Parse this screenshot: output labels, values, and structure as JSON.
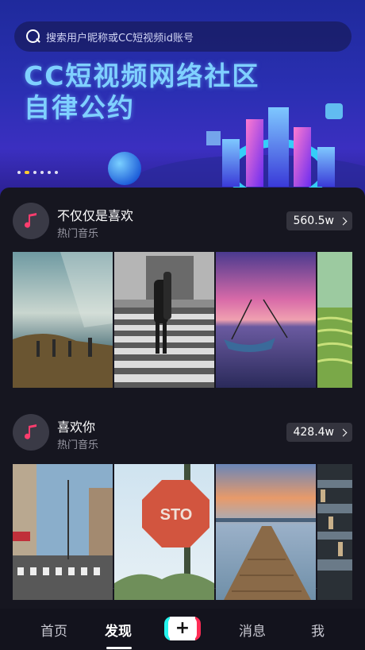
{
  "search": {
    "placeholder": "搜索用户昵称或CC短视频id账号"
  },
  "banner": {
    "title_line1": "CC短视频网络社区",
    "title_line2": "自律公约",
    "carousel_dots": 6,
    "carousel_active_index": 1
  },
  "sections": [
    {
      "title": "不仅仅是喜欢",
      "subtitle": "热门音乐",
      "count": "560.5w",
      "thumbs": [
        "sunbeam-coast-landscape",
        "bw-crosswalk-guitarist",
        "purple-sunset-boat",
        "green-rice-terraces"
      ]
    },
    {
      "title": "喜欢你",
      "subtitle": "热门音乐",
      "count": "428.4w",
      "thumbs": [
        "japanese-street",
        "stop-sign",
        "pier-sunset",
        "bookshelf"
      ]
    }
  ],
  "nav": {
    "home": "首页",
    "discover": "发现",
    "add": "+",
    "messages": "消息",
    "me": "我",
    "active": "discover"
  },
  "colors": {
    "accent_cyan": "#25f4ee",
    "accent_red": "#fe2c55",
    "music_note": "#ff3d6e",
    "background": "#161620"
  }
}
